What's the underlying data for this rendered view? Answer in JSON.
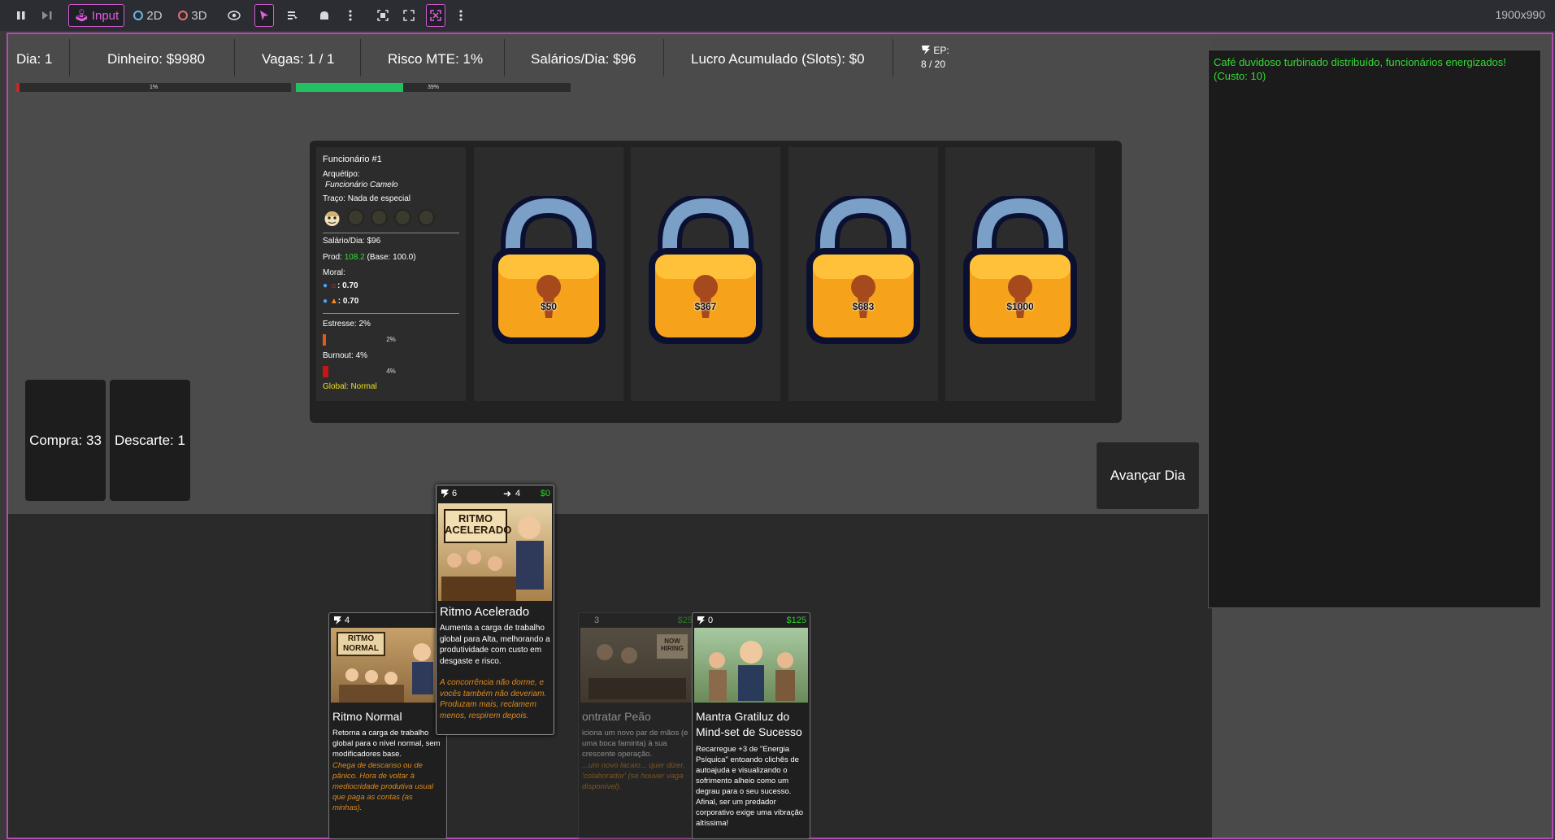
{
  "toolbar": {
    "input_label": "Input",
    "mode_2d": "2D",
    "mode_3d": "3D",
    "resolution": "1900x990"
  },
  "stats": {
    "day": "Dia: 1",
    "money": "Dinheiro: $9980",
    "vacancies": "Vagas: 1 / 1",
    "risk": "Risco MTE: 1%",
    "salaries": "Salários/Dia: $96",
    "profit": "Lucro Acumulado (Slots): $0",
    "ep_label": "EP:",
    "ep_value": "8 / 20",
    "risk_bar": {
      "text": "1%",
      "value": 0.01
    },
    "ep_bar": {
      "text": "39%",
      "value": 0.39
    },
    "colors": {
      "risk": "#c62828",
      "ep": "#22c060"
    }
  },
  "employee": {
    "name": "Funcionário #1",
    "archetype_label": "Arquétipo:",
    "archetype": "Funcionário Camelo",
    "trait": "Traço: Nada de especial",
    "salary": "Salário/Dia: $96",
    "prod_label": "Prod:",
    "prod_value": "108.2",
    "prod_base": "(Base: 100.0)",
    "moral_label": "Moral:",
    "moral_1": ": 0.70",
    "moral_2": ": 0.70",
    "stress_label": "Estresse: 2%",
    "stress_bar": {
      "text": "2%",
      "value": 0.02
    },
    "burnout_label": "Burnout: 4%",
    "burnout_bar": {
      "text": "4%",
      "value": 0.04
    },
    "global": "Global: Normal",
    "icons": [
      "face-icon",
      "slot-icon",
      "slot-icon",
      "slot-icon",
      "slot-icon"
    ]
  },
  "locked_slots": [
    {
      "price": "$50"
    },
    {
      "price": "$367"
    },
    {
      "price": "$683"
    },
    {
      "price": "$1000"
    }
  ],
  "piles": {
    "draw": "Compra: 33",
    "discard": "Descarte: 1"
  },
  "advance_button": "Avançar Dia",
  "log": {
    "message": "Café duvidoso turbinado distribuído, funcionários energizados! (Custo: 10)"
  },
  "cards": [
    {
      "id": "ritmo-normal",
      "ep_cost": "4",
      "art_text": "RITMO NORMAL",
      "title": "Ritmo Normal",
      "description": "Retorna a carga de trabalho global para o nível normal, sem modificadores base.",
      "flavor": "Chega de descanso ou de pânico. Hora de voltar à mediocridade produtiva usual que paga as contas (as minhas)."
    },
    {
      "id": "contratar-peao",
      "ep_cost": "3",
      "money_cost": "$25",
      "art_text": "NOW HIRING",
      "title": "ontratar Peão",
      "description": "iciona um novo par de mãos (e uma boca faminta) à sua crescente operação.",
      "flavor": "...um novo lacaio... quer dizer, 'colaborador' (se houver vaga disponível)."
    },
    {
      "id": "mantra",
      "ep_cost": "0",
      "money_cost": "$125",
      "title": "Mantra Gratiluz do Mind-set de Sucesso",
      "description": "Recarregue +3 de \"Energia Psíquica\" entoando clichês de autoajuda e visualizando o sofrimento alheio como um degrau para o seu sucesso. Afinal, ser um predador corporativo exige uma vibração altíssima!"
    },
    {
      "id": "ritmo-acelerado",
      "ep_cost": "6",
      "draw": "4",
      "money_cost": "$0",
      "art_text_1": "RITMO",
      "art_text_2": "ACELERADO",
      "title": "Ritmo Acelerado",
      "description": "Aumenta a carga de trabalho global para Alta, melhorando a produtividade com custo em desgaste e risco.",
      "flavor": "A concorrência não dorme, e vocês também não deveriam. Produzam mais, reclamem menos, respirem depois."
    }
  ]
}
